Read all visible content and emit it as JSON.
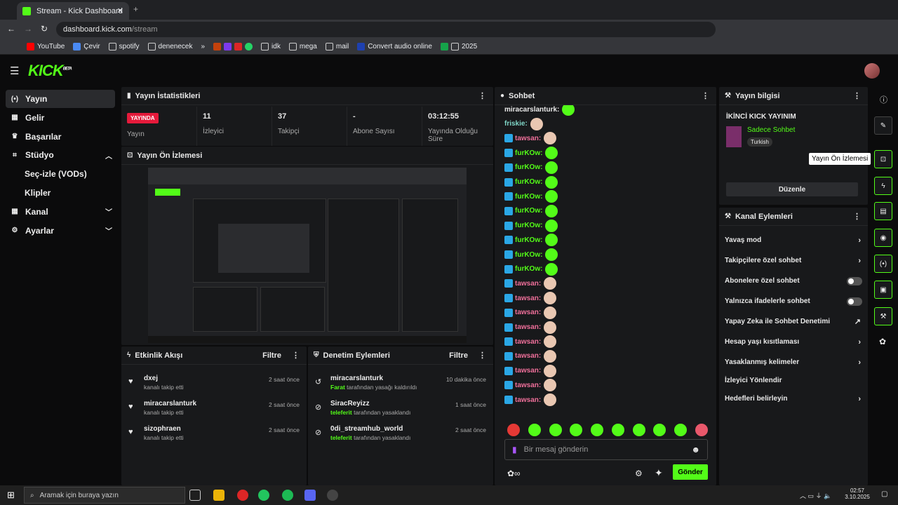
{
  "browser": {
    "tab_title": "Stream - Kick Dashboard",
    "url_domain": "dashboard.kick.com",
    "url_path": "/stream",
    "bookmarks": [
      "YouTube",
      "Çevir",
      "spotify",
      "denenecek",
      "»",
      "idk",
      "mega",
      "mail",
      "Convert audio online",
      "2025"
    ]
  },
  "logo": "KICK",
  "logo_sup": "BETA",
  "sidebar": [
    {
      "label": "Yayın",
      "icon": "(•)"
    },
    {
      "label": "Gelir",
      "icon": "▦"
    },
    {
      "label": "Başarılar",
      "icon": "🏆"
    },
    {
      "label": "Stüdyo",
      "icon": "⌗"
    },
    {
      "label": "Seç-izle (VODs)"
    },
    {
      "label": "Klipler"
    },
    {
      "label": "Kanal",
      "icon": "▦"
    },
    {
      "label": "Ayarlar",
      "icon": "⚙"
    }
  ],
  "stats": {
    "title": "Yayın İstatistikleri",
    "live": "YAYINDA",
    "live_label": "Yayın",
    "viewers": "11",
    "viewers_label": "İzleyici",
    "followers": "37",
    "followers_label": "Takipçi",
    "subs": "-",
    "subs_label": "Abone Sayısı",
    "uptime": "03:12:55",
    "uptime_label": "Yayında Olduğu Süre"
  },
  "preview": {
    "title": "Yayın Ön İzlemesi"
  },
  "activity": {
    "title": "Etkinlik Akışı",
    "filter": "Filtre",
    "items": [
      {
        "name": "dxej",
        "sub": "kanalı takip etti",
        "time": "2 saat önce"
      },
      {
        "name": "miracarslanturk",
        "sub": "kanalı takip etti",
        "time": "2 saat önce"
      },
      {
        "name": "sizophraen",
        "sub": "kanalı takip etti",
        "time": "2 saat önce"
      }
    ]
  },
  "moderation": {
    "title": "Denetim Eylemleri",
    "filter": "Filtre",
    "items": [
      {
        "name": "miracarslanturk",
        "by": "Farat",
        "sub": "tarafından yasağı kaldırıldı",
        "time": "10 dakika önce"
      },
      {
        "name": "SiracReyizz",
        "by": "teleferit",
        "sub": "tarafından yasaklandı",
        "time": "1 saat önce"
      },
      {
        "name": "0di_streamhub_world",
        "by": "teleferit",
        "sub": "tarafından yasaklandı",
        "time": "2 saat önce"
      }
    ]
  },
  "chat": {
    "title": "Sohbet",
    "placeholder": "Bir mesaj gönderin",
    "send": "Gönder",
    "lines": [
      {
        "user": "miracarslanturk:",
        "color": "#e8e8e8"
      },
      {
        "user": "friskie:",
        "color": "#7fd6c7"
      },
      {
        "user": "tawsan:",
        "color": "#ef6f9a"
      },
      {
        "user": "furKOw:",
        "color": "#53fc18"
      },
      {
        "user": "furKOw:",
        "color": "#53fc18"
      },
      {
        "user": "furKOw:",
        "color": "#53fc18"
      },
      {
        "user": "furKOw:",
        "color": "#53fc18"
      },
      {
        "user": "furKOw:",
        "color": "#53fc18"
      },
      {
        "user": "furKOw:",
        "color": "#53fc18"
      },
      {
        "user": "furKOw:",
        "color": "#53fc18"
      },
      {
        "user": "furKOw:",
        "color": "#53fc18"
      },
      {
        "user": "furKOw:",
        "color": "#53fc18"
      },
      {
        "user": "tawsan:",
        "color": "#ef6f9a"
      },
      {
        "user": "tawsan:",
        "color": "#ef6f9a"
      },
      {
        "user": "tawsan:",
        "color": "#ef6f9a"
      },
      {
        "user": "tawsan:",
        "color": "#ef6f9a"
      },
      {
        "user": "tawsan:",
        "color": "#ef6f9a"
      },
      {
        "user": "tawsan:",
        "color": "#ef6f9a"
      },
      {
        "user": "tawsan:",
        "color": "#ef6f9a"
      },
      {
        "user": "tawsan:",
        "color": "#ef6f9a"
      },
      {
        "user": "tawsan:",
        "color": "#ef6f9a"
      }
    ]
  },
  "info": {
    "title": "Yayın bilgisi",
    "stream_title": "İKİNCİ KICK YAYINIM",
    "category": "Sadece Sohbet",
    "tag": "Turkish",
    "edit": "Düzenle",
    "tooltip": "Yayın Ön İzlemesi"
  },
  "actions": {
    "title": "Kanal Eylemleri",
    "items": [
      "Yavaş mod",
      "Takipçilere özel sohbet",
      "Abonelere özel sohbet",
      "Yalnızca ifadelerle sohbet",
      "Yapay Zeka ile Sohbet Denetimi",
      "Hesap yaşı kısıtlaması",
      "Yasaklanmış kelimeler",
      "İzleyici Yönlendir",
      "Hedefleri belirleyin"
    ]
  },
  "taskbar": {
    "search": "Aramak için buraya yazın",
    "time": "02:57",
    "date": "3.10.2025"
  }
}
